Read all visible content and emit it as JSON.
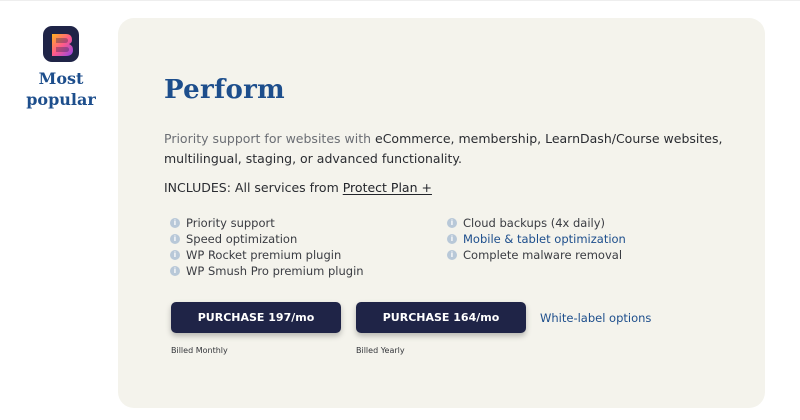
{
  "badge": {
    "label": "Most popular",
    "icon": "brand-logo-icon"
  },
  "plan": {
    "title": "Perform",
    "description_muted": "Priority support for websites with ",
    "description_main": "eCommerce, membership, LearnDash/Course websites, multilingual, staging, or advanced functionality.",
    "includes_label": "INCLUDES:",
    "includes_text": "All services from",
    "includes_link": "Protect Plan +"
  },
  "features_left": [
    {
      "label": "Priority support"
    },
    {
      "label": "Speed optimization"
    },
    {
      "label": "WP Rocket premium plugin"
    },
    {
      "label": "WP Smush Pro premium plugin"
    }
  ],
  "features_right": [
    {
      "label": "Cloud backups (4x daily)"
    },
    {
      "label": "Mobile & tablet optimization"
    },
    {
      "label": "Complete malware removal"
    }
  ],
  "purchase": {
    "monthly_label": "PURCHASE 197/mo",
    "monthly_note": "Billed Monthly",
    "yearly_label": "PURCHASE 164/mo",
    "yearly_note": "Billed Yearly",
    "white_label_link": "White-label options"
  },
  "colors": {
    "accent": "#1d4e8c",
    "button": "#1f2447",
    "card_bg": "#f4f3ec",
    "info_icon": "#b8c8d8"
  }
}
